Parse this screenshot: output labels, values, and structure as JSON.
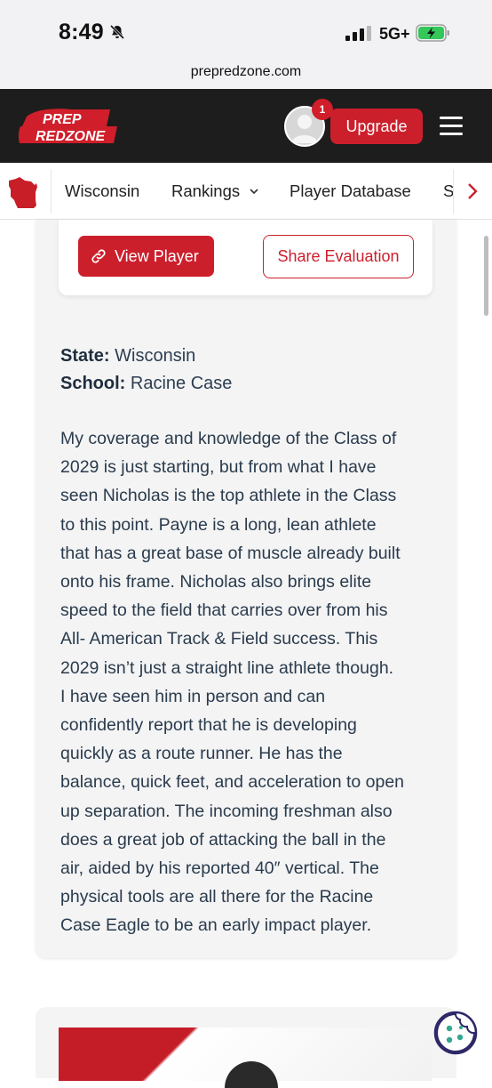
{
  "status_bar": {
    "time": "8:49",
    "network": "5G+"
  },
  "browser": {
    "url": "prepredzone.com"
  },
  "header": {
    "logo_text_top": "PREP",
    "logo_text_bottom": "REDZONE",
    "notification_count": "1",
    "upgrade_label": "Upgrade"
  },
  "nav": {
    "items": [
      "Wisconsin",
      "Rankings",
      "Player Database",
      "S"
    ]
  },
  "actions": {
    "view_player": "View Player",
    "share_evaluation": "Share Evaluation"
  },
  "profile": {
    "state_label": "State:",
    "state_value": "Wisconsin",
    "school_label": "School:",
    "school_value": "Racine Case"
  },
  "evaluation_lines": [
    "My coverage and knowledge of the Class of",
    "2029 is just starting, but from what I have",
    "seen Nicholas is the top athlete in the Class",
    "to this point. Payne is a long, lean athlete",
    "that has a great base of muscle already built",
    "onto his frame. Nicholas also brings elite",
    "speed to the field that carries over from his",
    "All- American Track & Field success. This",
    "2029 isn’t just a straight line athlete though.",
    "I have seen him in person and can",
    "confidently report that he is developing",
    "quickly as a route runner. He has the",
    "balance, quick feet, and acceleration to open",
    "up separation. The incoming freshman also",
    "does a great job of attacking the ball in the",
    "air, aided by his reported 40″ vertical. The",
    "physical tools are all there for the Racine",
    "Case Eagle to be an early impact player."
  ],
  "colors": {
    "brand_red": "#cc1f2c",
    "header_bg": "#1d1d1d"
  },
  "icons": [
    "mute-bell-icon",
    "signal-icon",
    "battery-charging-icon",
    "wisconsin-state-icon",
    "chevron-down-icon",
    "chevron-right-icon",
    "link-icon",
    "menu-icon",
    "cookie-icon"
  ]
}
